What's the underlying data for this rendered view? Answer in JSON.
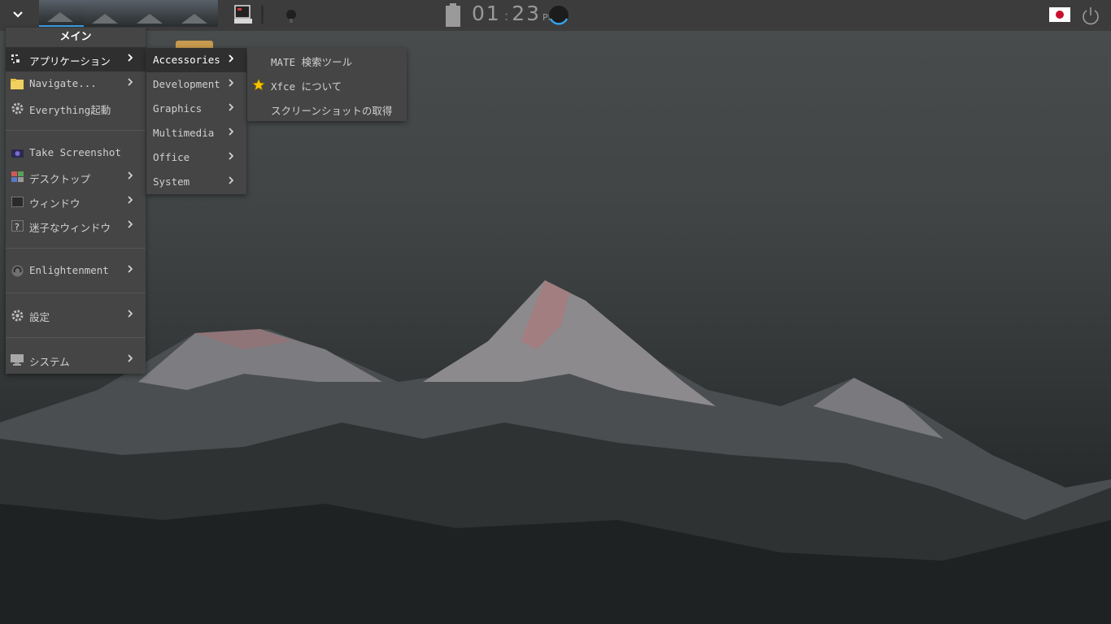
{
  "clock": {
    "hour": "01",
    "minute": "23",
    "ampm": "PM"
  },
  "main_menu": {
    "title": "メイン",
    "items": [
      {
        "label": "アプリケーション",
        "icon": "apps-icon",
        "submenu": true,
        "selected": true
      },
      {
        "label": "Navigate...",
        "icon": "folder-icon",
        "submenu": true
      },
      {
        "label": "Everything起動",
        "icon": "gear-icon",
        "submenu": false
      },
      {
        "label": "Take Screenshot",
        "icon": "camera-icon",
        "submenu": false
      },
      {
        "label": "デスクトップ",
        "icon": "desktop-icon",
        "submenu": true
      },
      {
        "label": "ウィンドウ",
        "icon": "window-icon",
        "submenu": true
      },
      {
        "label": "迷子なウィンドウ",
        "icon": "lost-window-icon",
        "submenu": true
      },
      {
        "label": "Enlightenment",
        "icon": "enlightenment-icon",
        "submenu": true
      },
      {
        "label": "設定",
        "icon": "settings-gear-icon",
        "submenu": true
      },
      {
        "label": "システム",
        "icon": "system-monitor-icon",
        "submenu": true
      }
    ]
  },
  "apps_menu": {
    "items": [
      {
        "label": "Accessories",
        "selected": true
      },
      {
        "label": "Development"
      },
      {
        "label": "Graphics"
      },
      {
        "label": "Multimedia"
      },
      {
        "label": "Office"
      },
      {
        "label": "System"
      }
    ]
  },
  "accessories_menu": {
    "items": [
      {
        "label": "MATE 検索ツール",
        "icon": ""
      },
      {
        "label": "Xfce について",
        "icon": "star-icon"
      },
      {
        "label": "スクリーンショットの取得",
        "icon": ""
      }
    ]
  },
  "colors": {
    "panel": "#3c3c3c",
    "menu": "#454545",
    "selected": "#2f2f2f",
    "accent": "#3aa0e8",
    "star": "#f5c400"
  }
}
